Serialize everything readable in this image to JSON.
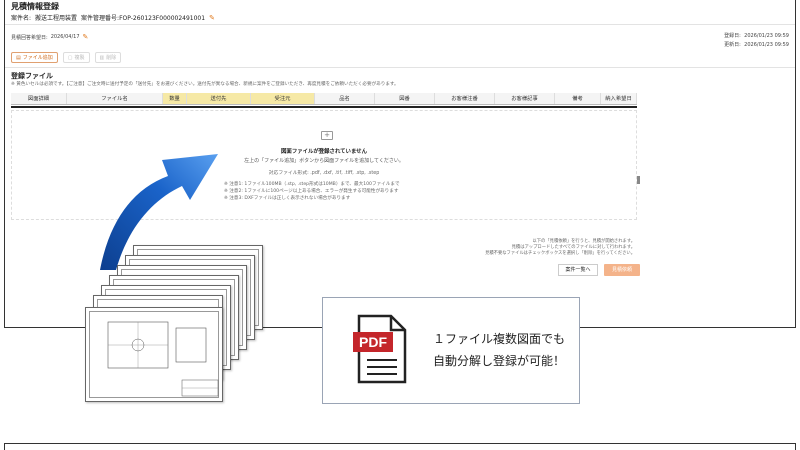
{
  "page": {
    "title": "見積情報登録",
    "case_label": "案件名:",
    "case_name": "搬送工程用装置",
    "case_number": "案件管理番号:FOP-260123F000002491001"
  },
  "dates": {
    "due_label": "見積回答希望日:",
    "due_value": "2026/04/17",
    "registered_label": "登録日:",
    "registered_value": "2026/01/23 09:59",
    "updated_label": "更新日:",
    "updated_value": "2026/01/23 09:59"
  },
  "toolbar": {
    "add_file": "ファイル追加",
    "copy": "複製",
    "delete": "削除"
  },
  "files": {
    "section_title": "登録ファイル",
    "note": "※ 黄色いセルは必須です。【ご注意】ご注文時に送付予定の「送付先」をお選びください。送付先が異なる場合、新規に案件をご登録いただき、再度見積をご依頼いただく必要があります。",
    "columns": [
      {
        "label": "図面詳細",
        "highlight": false,
        "w": 56
      },
      {
        "label": "ファイル名",
        "highlight": false,
        "w": 96
      },
      {
        "label": "数量",
        "highlight": true,
        "w": 24
      },
      {
        "label": "送付先",
        "highlight": true,
        "w": 64
      },
      {
        "label": "受注元",
        "highlight": true,
        "w": 64
      },
      {
        "label": "品名",
        "highlight": false,
        "w": 60
      },
      {
        "label": "図番",
        "highlight": false,
        "w": 60
      },
      {
        "label": "お客様注番",
        "highlight": false,
        "w": 60
      },
      {
        "label": "お客様記事",
        "highlight": false,
        "w": 60
      },
      {
        "label": "備考",
        "highlight": false,
        "w": 46
      },
      {
        "label": "納入希望日",
        "highlight": false,
        "w": 36
      }
    ],
    "empty_title": "図面ファイルが登録されていません",
    "empty_sub": "左上の「ファイル追加」ボタンから図面ファイルを追加してください。",
    "formats": "対応ファイル形式: .pdf, .dxf, .tif, .tiff, .stp, .step",
    "notes": [
      "※ 注意1: 1ファイル100MB（.stp, .step形式は10MB）まで、最大100ファイルまで",
      "※ 注意2: 1ファイルに100ページ以上ある場合、エラーが発生する可能性があります",
      "※ 注意3: DXFファイルは正しく表示されない場合があります"
    ]
  },
  "footer": {
    "notes": [
      "以下の「見積依頼」を行うと、見積が開始されます。",
      "見積はアップロードしたすべてのファイルに対して行われます。",
      "見積不要なファイルはチェックボックスを選択し「削除」を行ってください。"
    ],
    "back_button": "案件一覧へ",
    "submit_button": "見積依頼"
  },
  "callout": {
    "icon_text": "PDF",
    "line1": "１ファイル複数図面でも",
    "line2": "自動分解し登録が可能！"
  },
  "colors": {
    "accent": "#e07a1f",
    "highlight": "#f6e9a6",
    "arrow_blue": "#1a63c9",
    "pdf_red": "#c4262b"
  }
}
